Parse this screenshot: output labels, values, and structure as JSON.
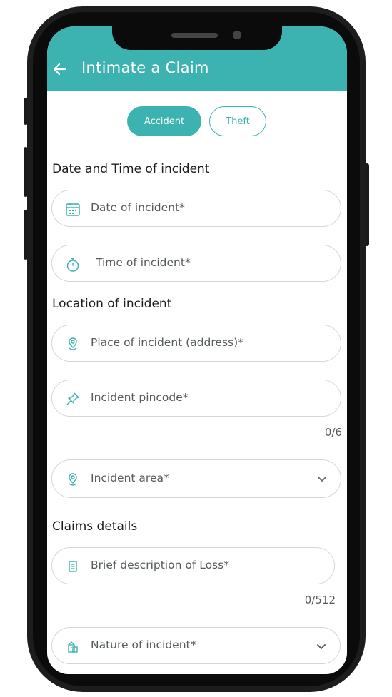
{
  "header": {
    "title": "Intimate a Claim"
  },
  "tabs": [
    {
      "label": "Accident"
    },
    {
      "label": "Theft"
    }
  ],
  "sections": {
    "datetime": "Date and Time of incident",
    "location": "Location of incident",
    "claims": "Claims details"
  },
  "fields": {
    "date": "Date of incident*",
    "time": "Time of incident*",
    "place": "Place of incident (address)*",
    "pincode": "Incident pincode*",
    "pincode_counter": "0/6",
    "area": "Incident area*",
    "description": "Brief description of Loss*",
    "description_counter": "0/512",
    "nature": "Nature of incident*"
  },
  "colors": {
    "accent": "#3db3b1",
    "border": "#d4d7d7",
    "text": "#1c1c1c"
  }
}
